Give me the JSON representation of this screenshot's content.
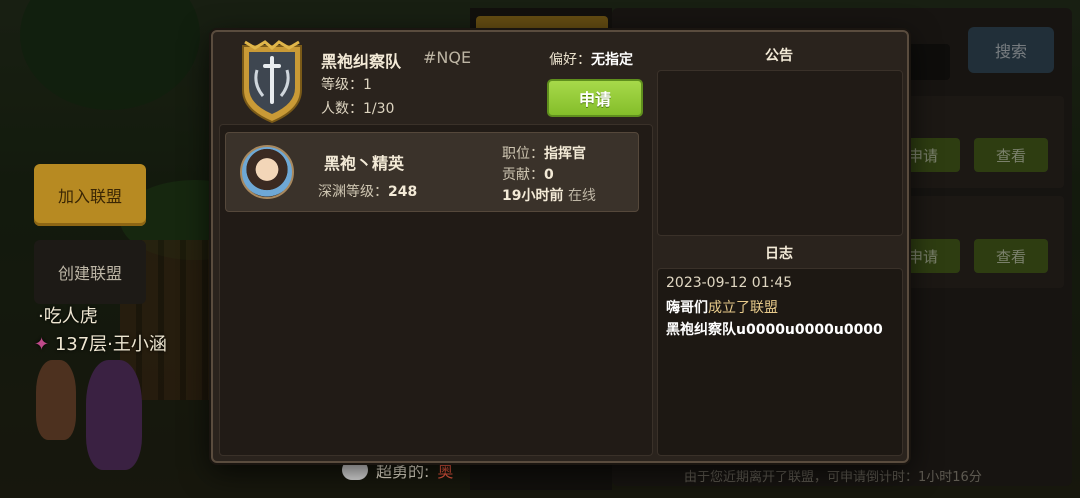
{
  "background": {
    "join_button": "加入联盟",
    "create_button": "创建联盟",
    "player_line_1": "·吃人虎",
    "player_line_2": "137层·王小涵",
    "search_button": "搜索",
    "row_buttons": [
      {
        "apply": "申请",
        "view": "查看"
      },
      {
        "apply": "申请",
        "view": "查看"
      }
    ],
    "chat_sender": "超勇的:",
    "chat_text": "奥",
    "footer_notice": "由于您近期离开了联盟，可申请倒计时：1小时16分",
    "partial_pref": "联盟偏好：无指定"
  },
  "modal": {
    "guild": {
      "name": "黑袍纠察队",
      "tag": "#NQE",
      "level_label": "等级：",
      "level_value": "1",
      "members_label": "人数：",
      "members_value": "1/30",
      "pref_label": "偏好：",
      "pref_value": "无指定",
      "apply_button": "申请"
    },
    "members": [
      {
        "name": "黑袍丶精英",
        "abyss_label": "深渊等级：",
        "abyss_value": "248",
        "role_label": "职位：",
        "role_value": "指挥官",
        "contrib_label": "贡献：",
        "contrib_value": "0",
        "last_seen": "19小时前",
        "status": "在线"
      }
    ],
    "notice": {
      "title": "公告",
      "content": ""
    },
    "log": {
      "title": "日志",
      "entries": [
        {
          "date": "2023-09-12 01:45",
          "actor": "嗨哥们",
          "action": "成立了联盟",
          "detail": "黑袍纠察队u0000u0000u0000"
        }
      ]
    }
  },
  "colors": {
    "apply_green": "#8cc432",
    "panel_bg": "#2a231d",
    "gold": "#b78a22"
  }
}
